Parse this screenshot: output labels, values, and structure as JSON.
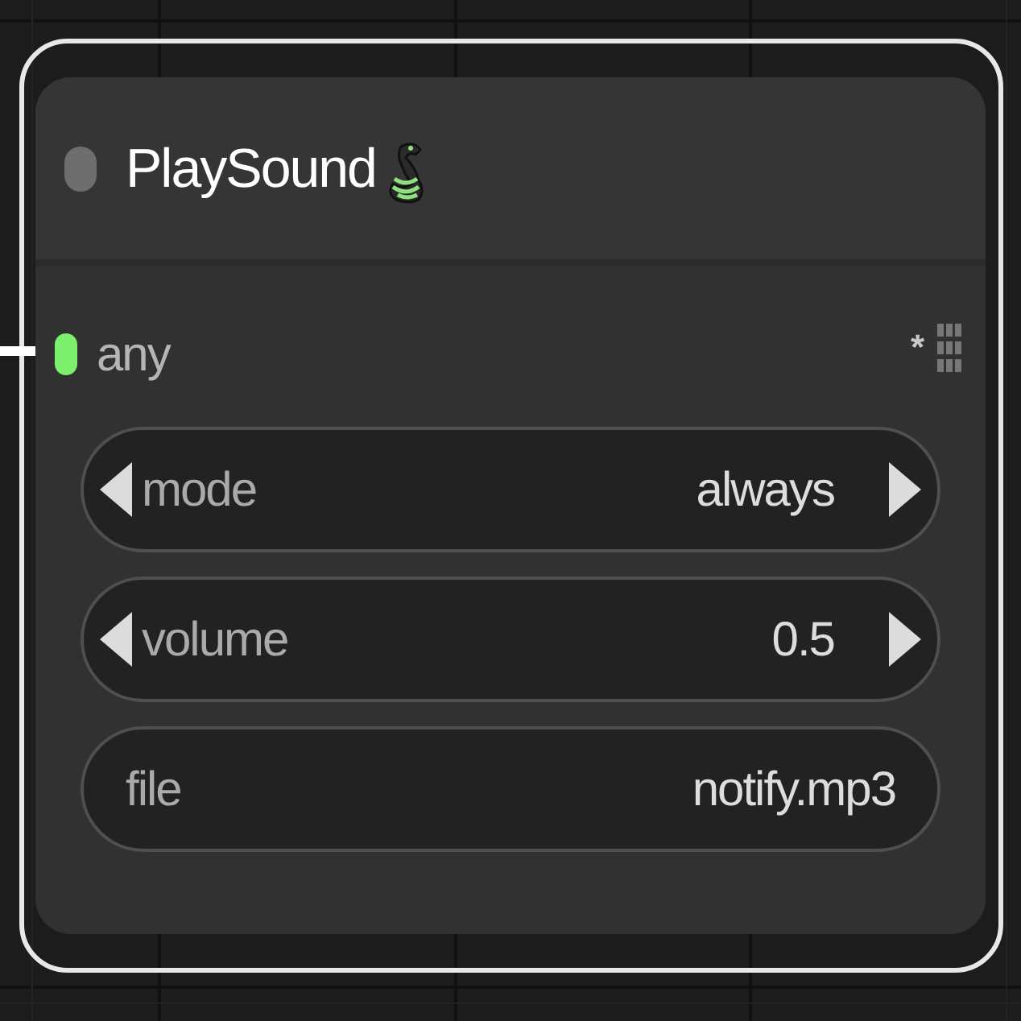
{
  "node": {
    "title": "PlaySound",
    "selected": true,
    "collapsed": false,
    "input": {
      "label": "any",
      "connected": true,
      "type_label": "*"
    },
    "widgets": [
      {
        "kind": "combo",
        "label": "mode",
        "value": "always"
      },
      {
        "kind": "number",
        "label": "volume",
        "value": "0.5"
      },
      {
        "kind": "text",
        "label": "file",
        "value": "notify.mp3"
      }
    ]
  }
}
